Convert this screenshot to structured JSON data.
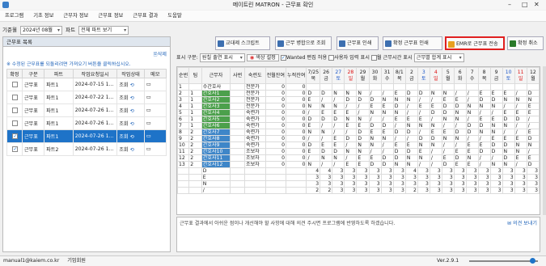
{
  "title": "메이트린 MATRON - 근무표 확인",
  "menu": [
    "프로그램",
    "기초 정보",
    "근무자 정보",
    "근무표 정보",
    "근무표 결과",
    "도움말"
  ],
  "filter": {
    "period_label": "기준월",
    "period_value": "2024년 08월",
    "part_label": "파트",
    "part_value": "전체 파트 보기"
  },
  "left": {
    "header": "근무표 목록",
    "delete": "삭제",
    "tip": "※ 수정된 근무표를 되돌리려면 가져오기 버튼을 클릭하십시오.",
    "columns": [
      "확정",
      "구분",
      "파트",
      "작업요청일시",
      "작업상태",
      "메모"
    ],
    "rows": [
      {
        "checked": false,
        "type": "근무표",
        "part": "파트1",
        "date": "2024-07-15 1...",
        "status": "조회"
      },
      {
        "checked": false,
        "type": "근무표",
        "part": "파트1",
        "date": "2024-07-22 1...",
        "status": "조회"
      },
      {
        "checked": false,
        "type": "근무표",
        "part": "파트1",
        "date": "2024-07-26 1...",
        "status": "조회"
      },
      {
        "checked": false,
        "type": "근무표",
        "part": "파트1",
        "date": "2024-07-26 1...",
        "status": "조회"
      },
      {
        "checked": true,
        "type": "근무표",
        "part": "파트1",
        "date": "2024-07-26 1...",
        "status": "조회",
        "selected": true
      },
      {
        "checked": true,
        "type": "근무표",
        "part": "파트2",
        "date": "2024-07-26 1...",
        "status": "조회"
      }
    ]
  },
  "toolbar": {
    "b1": "교대제 스크립트",
    "b2": "근무 병합으로 조회",
    "b3": "근무표 인쇄",
    "b4": "확정 근무표 인쇄",
    "b5": "EMR로 근무표 전송",
    "b6": "확정 취소"
  },
  "options": {
    "display_label": "표시 구분:",
    "display_value": "원칠 출연 표시",
    "color_btn": "색상 설정",
    "o1": "Wanted 편집 허용",
    "o2": "사용자 입력 표시",
    "o3": "월 근무시간 표시",
    "sum_value": "근무별 합계 표시"
  },
  "grid": {
    "head": [
      "순번",
      "팀",
      "근무자",
      "사번",
      "숙련도",
      "전월잔여",
      "누적잔여"
    ],
    "days": [
      [
        "7/25",
        "목"
      ],
      [
        "26",
        "금"
      ],
      [
        "27",
        "토"
      ],
      [
        "28",
        "일"
      ],
      [
        "29",
        "월"
      ],
      [
        "30",
        "화"
      ],
      [
        "31",
        "수"
      ],
      [
        "8/1",
        "목"
      ],
      [
        "2",
        "금"
      ],
      [
        "3",
        "토"
      ],
      [
        "4",
        "일"
      ],
      [
        "5",
        "월"
      ],
      [
        "6",
        "화"
      ],
      [
        "7",
        "수"
      ],
      [
        "8",
        "목"
      ],
      [
        "9",
        "금"
      ],
      [
        "10",
        "토"
      ],
      [
        "11",
        "일"
      ],
      [
        "12",
        "월"
      ]
    ],
    "rows": [
      {
        "no": "1",
        "team": "",
        "name": "수간호사",
        "id": "",
        "skill": "전문가",
        "prev": "0",
        "acc": "0",
        "d": [
          "",
          "",
          "",
          "",
          "",
          "",
          "",
          "",
          "",
          "",
          "",
          "",
          "",
          "",
          "",
          "",
          "",
          "",
          ""
        ]
      },
      {
        "no": "2",
        "team": "1",
        "name": "간호사1",
        "id": "",
        "skill": "전문가",
        "prev": "0",
        "acc": "0",
        "d": [
          "D",
          "D",
          "N",
          "N",
          "N",
          "/",
          "/",
          "E",
          "D",
          "D",
          "N",
          "N",
          "/",
          "/",
          "E",
          "E",
          "E",
          "/",
          "D"
        ]
      },
      {
        "no": "3",
        "team": "1",
        "name": "간호사2",
        "id": "",
        "skill": "전문가",
        "prev": "0",
        "acc": "0",
        "d": [
          "E",
          "/",
          "/",
          "D",
          "D",
          "D",
          "N",
          "N",
          "N",
          "/",
          "/",
          "E",
          "E",
          "/",
          "D",
          "D",
          "N",
          "N",
          "N"
        ]
      },
      {
        "no": "4",
        "team": "1",
        "name": "간호사3",
        "id": "",
        "skill": "전문가",
        "prev": "0",
        "acc": "0",
        "d": [
          "N",
          "N",
          "N",
          "/",
          "/",
          "E",
          "E",
          "D",
          "/",
          "E",
          "E",
          "D",
          "D",
          "N",
          "N",
          "N",
          "/",
          "/",
          "E"
        ]
      },
      {
        "no": "5",
        "team": "1",
        "name": "간호사4",
        "id": "",
        "skill": "숙련가",
        "prev": "0",
        "acc": "0",
        "d": [
          "/",
          "E",
          "E",
          "E",
          "/",
          "N",
          "N",
          "N",
          "/",
          "/",
          "D",
          "D",
          "N",
          "N",
          "/",
          "/",
          "E",
          "E",
          "E"
        ]
      },
      {
        "no": "6",
        "team": "1",
        "name": "간호사5",
        "id": "",
        "skill": "숙련가",
        "prev": "0",
        "acc": "0",
        "d": [
          "D",
          "D",
          "D",
          "N",
          "N",
          "/",
          "/",
          "E",
          "E",
          "E",
          "/",
          "N",
          "N",
          "/",
          "E",
          "E",
          "D",
          "D",
          "/"
        ]
      },
      {
        "no": "7",
        "team": "1",
        "name": "간호사6",
        "id": "",
        "skill": "숙련가",
        "prev": "0",
        "acc": "0",
        "d": [
          "E",
          "/",
          "/",
          "E",
          "E",
          "D",
          "D",
          "/",
          "N",
          "N",
          "N",
          "/",
          "/",
          "D",
          "D",
          "N",
          "N",
          "/",
          "/"
        ]
      },
      {
        "no": "8",
        "team": "2",
        "name": "간호사7",
        "id": "",
        "skill": "숙련가",
        "prev": "0",
        "acc": "0",
        "d": [
          "N",
          "N",
          "/",
          "/",
          "D",
          "E",
          "E",
          "D",
          "D",
          "/",
          "E",
          "E",
          "D",
          "D",
          "N",
          "N",
          "/",
          "/",
          "E"
        ]
      },
      {
        "no": "9",
        "team": "2",
        "name": "간호사8",
        "id": "",
        "skill": "숙련가",
        "prev": "0",
        "acc": "0",
        "d": [
          "/",
          "/",
          "E",
          "D",
          "D",
          "N",
          "N",
          "/",
          "/",
          "D",
          "D",
          "N",
          "N",
          "/",
          "/",
          "E",
          "E",
          "E",
          "D"
        ]
      },
      {
        "no": "10",
        "team": "2",
        "name": "간호사9",
        "id": "",
        "skill": "숙련가",
        "prev": "0",
        "acc": "0",
        "d": [
          "D",
          "E",
          "E",
          "/",
          "N",
          "N",
          "/",
          "E",
          "E",
          "N",
          "N",
          "/",
          "/",
          "E",
          "E",
          "D",
          "D",
          "N",
          "N"
        ]
      },
      {
        "no": "11",
        "team": "2",
        "name": "간호사10",
        "id": "",
        "skill": "조보자",
        "prev": "0",
        "acc": "0",
        "d": [
          "E",
          "D",
          "D",
          "N",
          "N",
          "/",
          "/",
          "D",
          "D",
          "E",
          "/",
          "/",
          "E",
          "E",
          "D",
          "D",
          "N",
          "N",
          "/"
        ]
      },
      {
        "no": "12",
        "team": "2",
        "name": "간호사11",
        "id": "",
        "skill": "조보자",
        "prev": "0",
        "acc": "0",
        "d": [
          "/",
          "N",
          "N",
          "/",
          "E",
          "E",
          "D",
          "D",
          "N",
          "N",
          "/",
          "E",
          "D",
          "N",
          "/",
          "/",
          "D",
          "E",
          "E"
        ]
      },
      {
        "no": "13",
        "team": "2",
        "name": "간호사12",
        "id": "",
        "skill": "조보자",
        "prev": "0",
        "acc": "0",
        "d": [
          "N",
          "/",
          "/",
          "E",
          "E",
          "D",
          "D",
          "N",
          "N",
          "/",
          "/",
          "D",
          "E",
          "E",
          "/",
          "N",
          "N",
          "/",
          "D"
        ]
      }
    ],
    "summary": [
      {
        "label": "D",
        "d": [
          "4",
          "4",
          "3",
          "3",
          "3",
          "3",
          "3",
          "3",
          "4",
          "3",
          "3",
          "3",
          "3",
          "3",
          "3",
          "3",
          "3",
          "3",
          "3"
        ]
      },
      {
        "label": "E",
        "d": [
          "3",
          "3",
          "3",
          "3",
          "3",
          "3",
          "3",
          "3",
          "3",
          "3",
          "3",
          "3",
          "3",
          "3",
          "3",
          "3",
          "3",
          "3",
          "3"
        ]
      },
      {
        "label": "N",
        "d": [
          "3",
          "3",
          "3",
          "3",
          "3",
          "3",
          "3",
          "3",
          "3",
          "3",
          "3",
          "3",
          "3",
          "3",
          "3",
          "3",
          "3",
          "3",
          "3"
        ]
      },
      {
        "label": "/",
        "d": [
          "2",
          "2",
          "3",
          "3",
          "3",
          "3",
          "3",
          "3",
          "2",
          "3",
          "3",
          "3",
          "3",
          "3",
          "3",
          "3",
          "3",
          "3",
          "3"
        ]
      }
    ]
  },
  "memo": {
    "text": "근무표 결과에서 아쉬운 점이나 개선해야 할 사항에 대해 의견 주시면 프로그램에 반영하도록 하겠습니다.",
    "btn": "의견 보내기"
  },
  "right_tab": "병동 요일 표시",
  "status": {
    "user": "manual1@kaiem.co.kr",
    "org": "기업회원",
    "version": "Ver.2.9.1"
  }
}
